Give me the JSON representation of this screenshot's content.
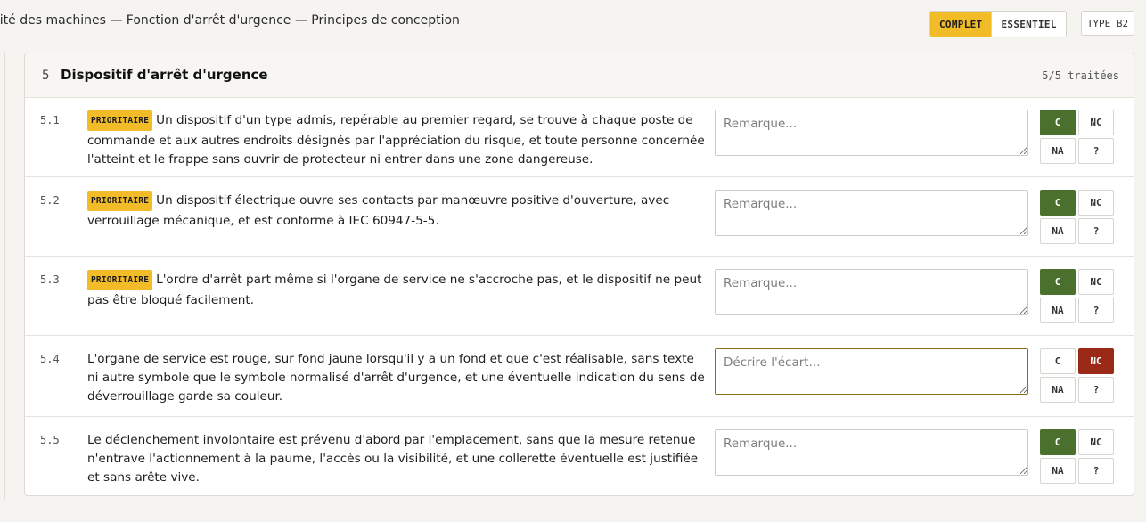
{
  "header": {
    "doc_title": "rité des machines — Fonction d'arrêt d'urgence — Principes de conception",
    "mode_complete": "COMPLET",
    "mode_essential": "ESSENTIEL",
    "type_badge": "TYPE B2"
  },
  "section": {
    "number": "5",
    "title": "Dispositif d'arrêt d'urgence",
    "count": "5/5 traitées"
  },
  "labels": {
    "priority": "PRIORITAIRE",
    "c": "C",
    "nc": "NC",
    "na": "NA",
    "unknown": "?"
  },
  "items": [
    {
      "num": "5.1",
      "priority": true,
      "text": "Un dispositif d'un type admis, repérable au premier regard, se trouve à chaque poste de commande et aux autres endroits désignés par l'appréciation du risque, et toute personne concernée l'atteint et le frappe sans ouvrir de protecteur ni entrer dans une zone dangereuse.",
      "placeholder": "Remarque...",
      "status": "C"
    },
    {
      "num": "5.2",
      "priority": true,
      "text": "Un dispositif électrique ouvre ses contacts par manœuvre positive d'ouverture, avec verrouillage mécanique, et est conforme à IEC 60947-5-5.",
      "placeholder": "Remarque...",
      "status": "C"
    },
    {
      "num": "5.3",
      "priority": true,
      "text": "L'ordre d'arrêt part même si l'organe de service ne s'accroche pas, et le dispositif ne peut pas être bloqué facilement.",
      "placeholder": "Remarque...",
      "status": "C"
    },
    {
      "num": "5.4",
      "priority": false,
      "text": "L'organe de service est rouge, sur fond jaune lorsqu'il y a un fond et que c'est réalisable, sans texte ni autre symbole que le symbole normalisé d'arrêt d'urgence, et une éventuelle indication du sens de déverrouillage garde sa couleur.",
      "placeholder": "Décrire l'écart...",
      "status": "NC"
    },
    {
      "num": "5.5",
      "priority": false,
      "text": "Le déclenchement involontaire est prévenu d'abord par l'emplacement, sans que la mesure retenue n'entrave l'actionnement à la paume, l'accès ou la visibilité, et une collerette éventuelle est justifiée et sans arête vive.",
      "placeholder": "Remarque...",
      "status": "C"
    }
  ],
  "colors": {
    "accent_yellow": "#f2bb28",
    "compliant_green": "#4b6f2c",
    "nonconform_red": "#9a2a17"
  }
}
